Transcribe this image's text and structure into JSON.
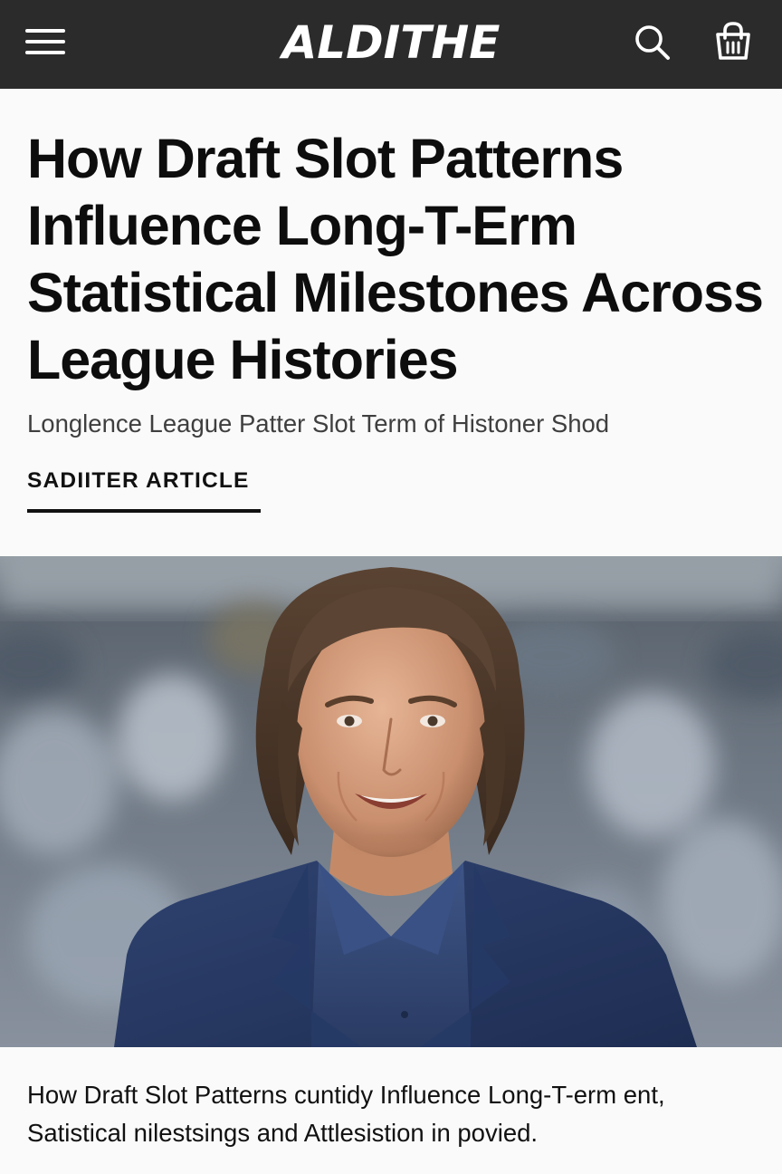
{
  "header": {
    "logo_text": "ALDITHE",
    "menu_icon": "hamburger-menu-icon",
    "search_icon": "search-icon",
    "cart_icon": "shopping-bag-icon",
    "background_color": "#2b2b2b",
    "foreground_color": "#ffffff"
  },
  "article": {
    "headline": "How Draft Slot Patterns Influence Long-T-Erm Statistical Milestones Across League Histories",
    "subheadline": "Longlence League Patter Slot Term of Histoner Shod",
    "tag_label": "SADIITER ARTICLE",
    "hero_image": "photo-of-smiling-man-with-long-hair-in-navy-blazer-at-stadium",
    "caption": "How Draft Slot Patterns cuntidy Influence Long-T-erm ent, Satistical nilestsings and Attlesistion in povied."
  }
}
